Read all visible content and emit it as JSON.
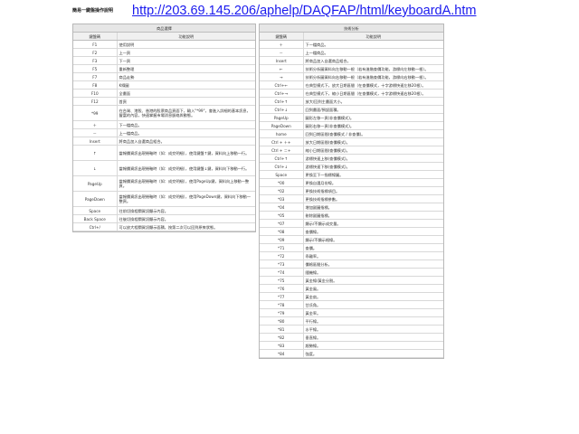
{
  "page": {
    "heading": "簡易一鍵盤操作說明",
    "url": "http://203.69.145.206/aphelp/DAQFAP/html/keyboardA.htm"
  },
  "left_panel": {
    "title": "商品選擇",
    "col_key": "鍵盤碼",
    "col_desc": "功能說明",
    "rows": [
      {
        "key": "F1",
        "desc": "使用說明"
      },
      {
        "key": "F2",
        "desc": "上一頁"
      },
      {
        "key": "F3",
        "desc": "下一頁"
      },
      {
        "key": "F5",
        "desc": "重新整理"
      },
      {
        "key": "F7",
        "desc": "商品走勢"
      },
      {
        "key": "F8",
        "desc": "K線圖"
      },
      {
        "key": "F10",
        "desc": "全畫面"
      },
      {
        "key": "F12",
        "desc": "首頁"
      },
      {
        "key": "*99",
        "desc": "在台灣、港股、香港的股票商品頁面下，輸入\"*99\"，會進入詳細的基本訊息，豐富的內容，快速掌握市場消息脈絡與動態。"
      },
      {
        "key": "＋",
        "desc": "下一檔商品。"
      },
      {
        "key": "－",
        "desc": "上一檔商品。"
      },
      {
        "key": "Insert",
        "desc": "將商品加入自選商品組合。"
      },
      {
        "key": "↑",
        "desc": "當報價資訊出現捲軸時（如：成交明細），使用鍵盤↑鍵，資料向上移動一行。"
      },
      {
        "key": "↓",
        "desc": "當報價資訊出現捲軸時（如：成交明細），使用鍵盤↓鍵，資料向下移動一行。"
      },
      {
        "key": "PageUp",
        "desc": "當報價資訊出現捲軸時（如：成交明細），使用PageUp鍵，資料向上移動一整頁。"
      },
      {
        "key": "PageDown",
        "desc": "當報價資訊出現捲軸時（如：成交明細），使用PageDown鍵，資料向下移動一整頁。"
      },
      {
        "key": "Space",
        "desc": "往前切換相關資訊顯示內容。"
      },
      {
        "key": "Back Space",
        "desc": "往後切換相關資訊顯示內容。"
      },
      {
        "key": "Ctrl+/",
        "desc": "可以放大相關資訊顯示面積，按第二次可以回到原來狀態。"
      }
    ]
  },
  "right_panel": {
    "title": "技術分析",
    "col_key": "鍵盤碼",
    "col_desc": "功能說明",
    "rows": [
      {
        "key": "＋",
        "desc": "下一檔商品。"
      },
      {
        "key": "－",
        "desc": "上一檔商品。"
      },
      {
        "key": "Insert",
        "desc": "將商品加入自選商品組合。"
      },
      {
        "key": "←",
        "desc": "技術分析圖資料向左移動一根（若有進階查價功能，游標向左移動一根）。"
      },
      {
        "key": "→",
        "desc": "技術分析圖資料向右移動一根（若有進階查價功能，游標向右移動一根）。"
      },
      {
        "key": "Ctrl+←",
        "desc": "在典型模式下，放大日期區間（在查價模式，十字游標快速左移20根）。"
      },
      {
        "key": "Ctrl+→",
        "desc": "在典型模式下，縮小日期區間（在查價模式，十字游標快速右移20根）。"
      },
      {
        "key": "Ctrl+↑",
        "desc": "放大/回到主畫面大小。"
      },
      {
        "key": "Ctrl+↓",
        "desc": "回到畫面/預設面積。"
      },
      {
        "key": "PageUp",
        "desc": "圖形左移一頁(非查價模式)。"
      },
      {
        "key": "PageDown",
        "desc": "圖形右移一頁(非查價模式)。"
      },
      {
        "key": "home",
        "desc": "回到日期區間(查價模式 / 非查價)。"
      },
      {
        "key": "Ctrl + ＋+",
        "desc": "放大日期區間(查價模式)。"
      },
      {
        "key": "Ctrl + ＝+",
        "desc": "縮小日期區間(查價模式)。"
      },
      {
        "key": "Ctrl+↑",
        "desc": "游標快速上移(查價模式)。"
      },
      {
        "key": "Ctrl+↓",
        "desc": "游標快速下移(查價模式)。"
      },
      {
        "key": "Space",
        "desc": "更換至下一指標線圖。"
      },
      {
        "key": "*00",
        "desc": "更換自選月份線。"
      },
      {
        "key": "*02",
        "desc": "更換技術指標項目。"
      },
      {
        "key": "*03",
        "desc": "更換技術指標參數。"
      },
      {
        "key": "*04",
        "desc": "增加副圖指標。"
      },
      {
        "key": "*05",
        "desc": "刪除副圖指標。"
      },
      {
        "key": "*07",
        "desc": "顯示/不顯示成交量。"
      },
      {
        "key": "*08",
        "desc": "查價線。"
      },
      {
        "key": "*09",
        "desc": "顯示/不顯示格線。"
      },
      {
        "key": "*71",
        "desc": "查價。"
      },
      {
        "key": "*72",
        "desc": "乖離率。"
      },
      {
        "key": "*73",
        "desc": "價格區間分析。"
      },
      {
        "key": "*74",
        "desc": "隨機線。"
      },
      {
        "key": "*75",
        "desc": "黃金線/黃金分割。"
      },
      {
        "key": "*76",
        "desc": "黃金風。"
      },
      {
        "key": "*77",
        "desc": "黃金扇。"
      },
      {
        "key": "*78",
        "desc": "甘氏角。"
      },
      {
        "key": "*79",
        "desc": "黃金率。"
      },
      {
        "key": "*80",
        "desc": "平行線。"
      },
      {
        "key": "*81",
        "desc": "水平線。"
      },
      {
        "key": "*82",
        "desc": "垂直線。"
      },
      {
        "key": "*83",
        "desc": "趨勢線。"
      },
      {
        "key": "*84",
        "desc": "強度。"
      }
    ]
  }
}
